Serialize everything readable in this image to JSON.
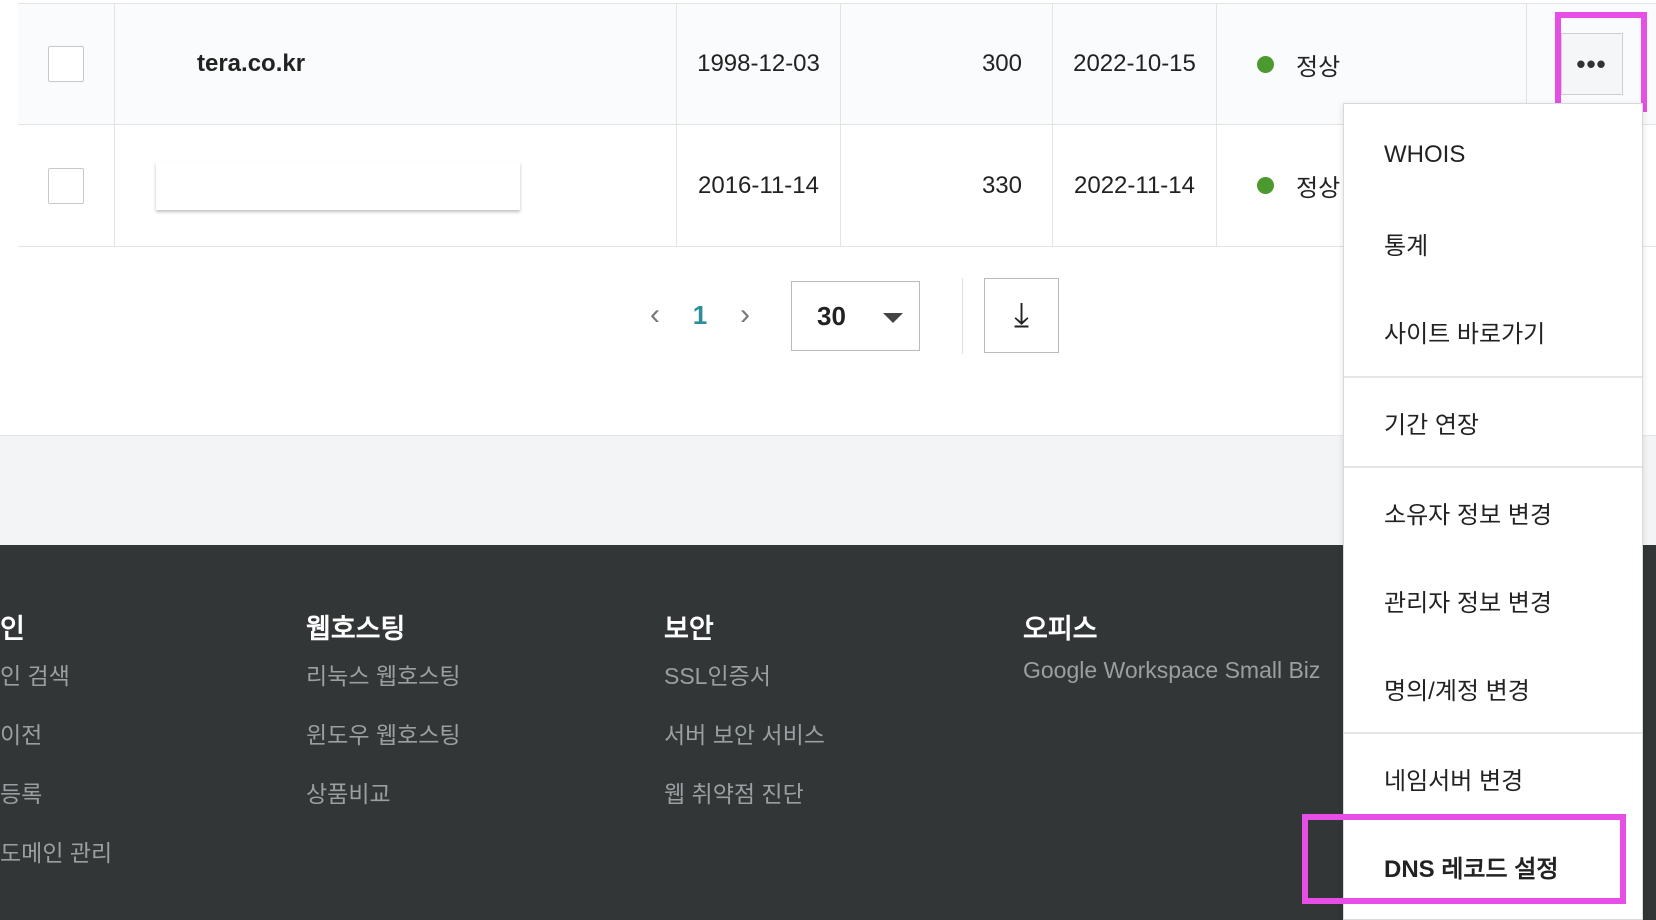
{
  "rows": [
    {
      "domain": "tera.co.kr",
      "registered": "1998-12-03",
      "days": "300",
      "expires": "2022-10-15",
      "status": "정상"
    },
    {
      "domain": "",
      "registered": "2016-11-14",
      "days": "330",
      "expires": "2022-11-14",
      "status": "정상"
    }
  ],
  "colors": {
    "status_ok": "#4b9a2f",
    "accent": "#2e8e9a",
    "highlight": "#e64ee6",
    "footer_bg": "#323637"
  },
  "more_button": {
    "label": "•••"
  },
  "pagination": {
    "prev": "‹",
    "current": "1",
    "next": "›",
    "per_page": "30",
    "download_icon": "⤓"
  },
  "footer": {
    "columns": [
      {
        "title": "인",
        "links": [
          "인 검색",
          "이전",
          "등록",
          "도메인 관리"
        ]
      },
      {
        "title": "웹호스팅",
        "links": [
          "리눅스 웹호스팅",
          "윈도우 웹호스팅",
          "상품비교"
        ]
      },
      {
        "title": "보안",
        "links": [
          "SSL인증서",
          "서버 보안 서비스",
          "웹 취약점 진단"
        ]
      },
      {
        "title": "오피스",
        "links": [
          "Google Workspace Small Biz"
        ]
      }
    ]
  },
  "menu": {
    "items": [
      "WHOIS",
      "통계",
      "사이트 바로가기",
      "기간 연장",
      "소유자 정보 변경",
      "관리자 정보 변경",
      "명의/계정 변경",
      "네임서버 변경",
      "DNS 레코드 설정"
    ]
  }
}
